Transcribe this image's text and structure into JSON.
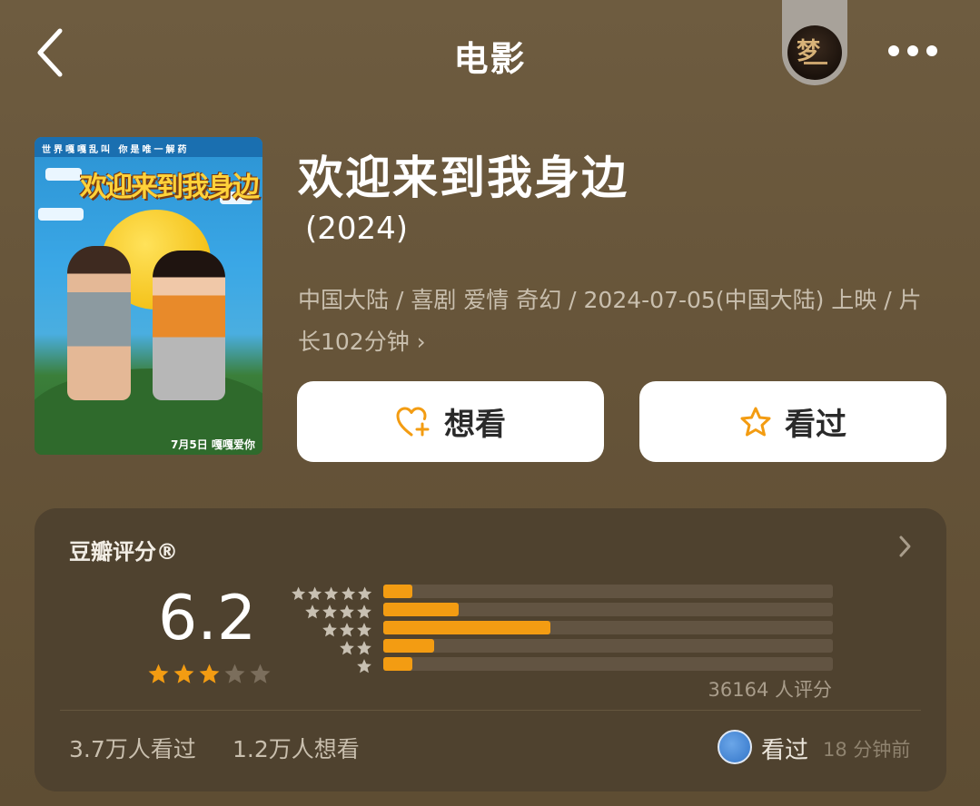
{
  "header": {
    "title": "电影"
  },
  "movie": {
    "name": "欢迎来到我身边",
    "year": "(2024)",
    "meta": "中国大陆 / 喜剧 爱情 奇幻 / 2024-07-05(中国大陆) 上映 / 片长102分钟",
    "meta_chevron": "›",
    "poster": {
      "top_text": "世界嘎嘎乱叫 你是唯一解药",
      "title_text": "欢迎来到我身边",
      "bottom_text": "7月5日 嘎嘎爱你"
    }
  },
  "actions": {
    "want_label": "想看",
    "seen_label": "看过"
  },
  "rating": {
    "title": "豆瓣评分®",
    "score": "6.2",
    "score_stars_filled": 3,
    "score_stars_total": 5,
    "distribution_percent": [
      6.5,
      16.9,
      37.6,
      11.5,
      6.5
    ],
    "distribution_labels": [
      "5星",
      "4星",
      "3星",
      "2星",
      "1星"
    ],
    "count_text": "36164 人评分"
  },
  "stats": {
    "seen": "3.7万人看过",
    "want": "1.2万人想看"
  },
  "my_status": {
    "label": "看过",
    "time": "18 分钟前"
  },
  "colors": {
    "accent": "#f39c12",
    "background": "#6b5a3e",
    "card": "#4f422f"
  },
  "icons": [
    "back-arrow-icon",
    "more-icon",
    "heart-plus-icon",
    "star-icon",
    "chevron-right-icon"
  ]
}
